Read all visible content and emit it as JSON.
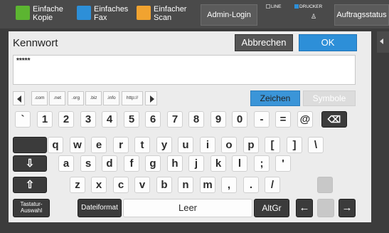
{
  "topbar": {
    "modes": [
      {
        "line1": "Einfache",
        "line2": "Kopie",
        "color": "#5cb531"
      },
      {
        "line1": "Einfaches",
        "line2": "Fax",
        "color": "#2d8fd8"
      },
      {
        "line1": "Einfacher",
        "line2": "Scan",
        "color": "#f1a330"
      }
    ],
    "admin_login": "Admin-Login",
    "status_line": "LINE",
    "status_printer": "DRUCKER",
    "job_status": "Auftragsstatus"
  },
  "dialog": {
    "title": "Kennwort",
    "cancel": "Abbrechen",
    "ok": "OK",
    "input_value": "*****"
  },
  "domains": [
    ".com",
    ".net",
    ".org",
    ".biz",
    ".info",
    "http://"
  ],
  "mode_tabs": {
    "chars": "Zeichen",
    "symbols": "Symbole"
  },
  "keys": {
    "row1": [
      "`",
      "1",
      "2",
      "3",
      "4",
      "5",
      "6",
      "7",
      "8",
      "9",
      "0",
      "-",
      "=",
      "@"
    ],
    "row2": [
      "q",
      "w",
      "e",
      "r",
      "t",
      "y",
      "u",
      "i",
      "o",
      "p",
      "[",
      "]",
      "\\"
    ],
    "row3": [
      "a",
      "s",
      "d",
      "f",
      "g",
      "h",
      "j",
      "k",
      "l",
      ";",
      "'"
    ],
    "row4": [
      "z",
      "x",
      "c",
      "v",
      "b",
      "n",
      "m",
      ",",
      ".",
      "/"
    ],
    "backspace_glyph": "⌫",
    "tab_glyph": "⇩",
    "shift_glyph": "⇧",
    "keyboard_select_1": "Tastatur-",
    "keyboard_select_2": "Auswahl",
    "file_format": "Dateiformat",
    "space": "Leer",
    "altgr": "AltGr",
    "left_arrow": "←",
    "right_arrow": "→"
  },
  "colors": {
    "accent": "#2d8fd8",
    "dark_key": "#3b3b3b"
  }
}
